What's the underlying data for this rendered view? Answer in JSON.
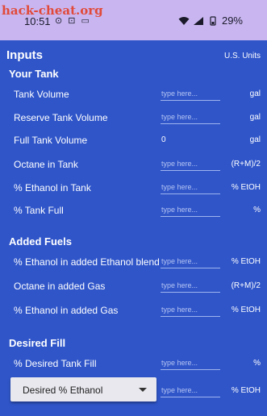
{
  "status_bar": {
    "watermark": "hack-cheat.org",
    "time": "10:51",
    "notification_icons": "⊙ ⊡ ▭",
    "battery": "29%"
  },
  "header": {
    "title": "Inputs",
    "units": "U.S. Units"
  },
  "placeholder": "type here...",
  "sections": {
    "tank": "Your Tank",
    "added": "Added Fuels",
    "desired": "Desired Fill"
  },
  "rows": [
    {
      "label": "Tank Volume",
      "value": "type here...",
      "unit": "gal"
    },
    {
      "label": "Reserve Tank Volume",
      "value": "type here...",
      "unit": "gal"
    },
    {
      "label": "Full Tank Volume",
      "value": "0",
      "unit": "gal"
    },
    {
      "label": "Octane in Tank",
      "value": "type here...",
      "unit": "(R+M)/2"
    },
    {
      "label": "% Ethanol in Tank",
      "value": "type here...",
      "unit": "% EtOH"
    },
    {
      "label": "% Tank Full",
      "value": "type here...",
      "unit": "%"
    },
    {
      "label": "% Ethanol in added Ethanol blend",
      "value": "type here...",
      "unit": "% EtOH"
    },
    {
      "label": "Octane in added Gas",
      "value": "type here...",
      "unit": "(R+M)/2"
    },
    {
      "label": "% Ethanol in added Gas",
      "value": "type here...",
      "unit": "% EtOH"
    },
    {
      "label": "% Desired Tank Fill",
      "value": "type here...",
      "unit": "%"
    }
  ],
  "desired_select": {
    "selected": "Desired % Ethanol",
    "value": "type here...",
    "unit": "% EtOH"
  },
  "colors": {
    "background": "#2f55c9",
    "status_bar": "#c9b6f0",
    "text": "#ffffff"
  }
}
